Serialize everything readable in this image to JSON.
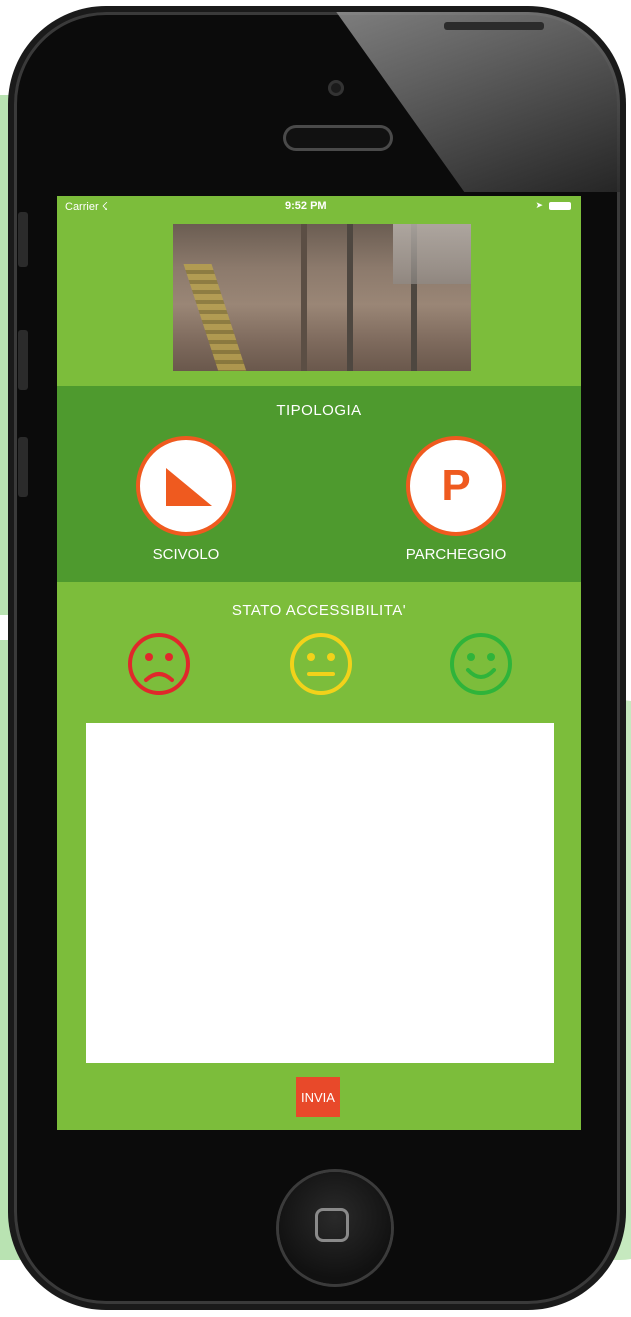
{
  "status_bar": {
    "carrier": "Carrier",
    "time": "9:52 PM"
  },
  "photo": {
    "alt": "sidewalk photo"
  },
  "tipologia": {
    "title": "TIPOLOGIA",
    "options": [
      {
        "label": "SCIVOLO",
        "icon": "ramp-icon"
      },
      {
        "label": "PARCHEGGIO",
        "icon": "parking-icon",
        "glyph": "P"
      }
    ]
  },
  "stato": {
    "title": "STATO ACCESSIBILITA'",
    "faces": [
      {
        "icon": "sad-face-icon",
        "color": "#e0282b"
      },
      {
        "icon": "neutral-face-icon",
        "color": "#f2d21a"
      },
      {
        "icon": "happy-face-icon",
        "color": "#2fb43a"
      }
    ]
  },
  "description": {
    "value": ""
  },
  "send_button": {
    "label": "INVIA"
  },
  "colors": {
    "screen_bg": "#7cbd3b",
    "section_dark": "#4e9a2e",
    "accent": "#ef5a1f",
    "send": "#e8492a"
  }
}
